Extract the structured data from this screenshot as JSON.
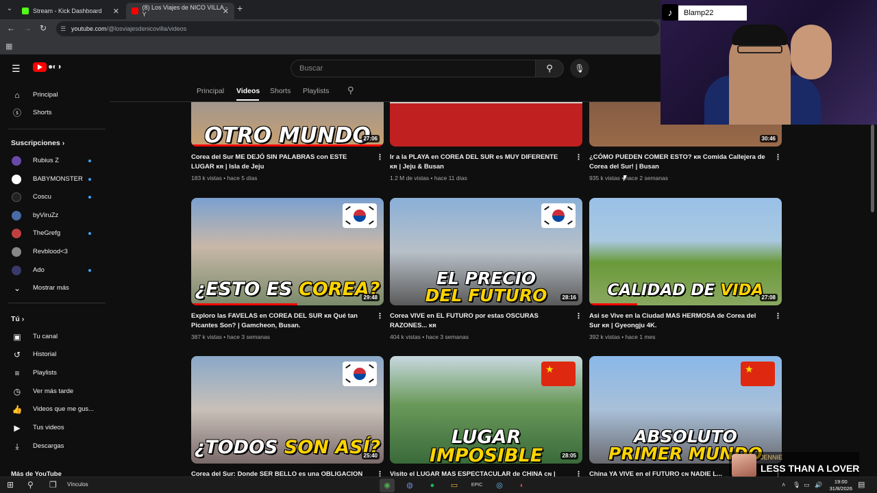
{
  "browser": {
    "tabs": [
      {
        "title": "Stream - Kick Dashboard",
        "favicon_color": "#53fc18"
      },
      {
        "title": "(8) Los Viajes de NICO VILLA - Y",
        "favicon_color": "#ff0000"
      }
    ],
    "url_host": "youtube.com",
    "url_path": "/@losviajesdenicovilla/videos"
  },
  "youtube": {
    "search_placeholder": "Buscar",
    "channel_tabs": [
      "Principal",
      "Videos",
      "Shorts",
      "Playlists"
    ],
    "active_tab": "Videos"
  },
  "sidebar": {
    "main": [
      {
        "label": "Principal",
        "icon": "home-icon"
      },
      {
        "label": "Shorts",
        "icon": "shorts-icon"
      }
    ],
    "subs_heading": "Suscripciones",
    "subscriptions": [
      {
        "label": "Rubius Z",
        "avatar_color": "#6a4aa8",
        "live_dot": true
      },
      {
        "label": "BABYMONSTER",
        "avatar_color": "#ffffff",
        "live_dot": true
      },
      {
        "label": "Coscu",
        "avatar_color": "#222222",
        "live_dot": true
      },
      {
        "label": "byViruZz",
        "avatar_color": "#4a6aa8",
        "live_dot": false
      },
      {
        "label": "TheGrefg",
        "avatar_color": "#c04040",
        "live_dot": true
      },
      {
        "label": "Revblood<3",
        "avatar_color": "#888888",
        "live_dot": false
      },
      {
        "label": "Ado",
        "avatar_color": "#3a3a6a",
        "live_dot": true
      }
    ],
    "show_more": "Mostrar más",
    "you_heading": "Tú",
    "you_items": [
      {
        "label": "Tu canal",
        "icon": "channel-icon"
      },
      {
        "label": "Historial",
        "icon": "history-icon"
      },
      {
        "label": "Playlists",
        "icon": "playlists-icon"
      },
      {
        "label": "Ver más tarde",
        "icon": "watch-later-icon"
      },
      {
        "label": "Videos que me gus...",
        "icon": "like-icon"
      },
      {
        "label": "Tus videos",
        "icon": "your-videos-icon"
      },
      {
        "label": "Descargas",
        "icon": "downloads-icon"
      }
    ],
    "more_heading": "Más de YouTube"
  },
  "videos": [
    {
      "title": "Corea del Sur ME DEJÓ SIN PALABRAS con ESTE LUGAR ᴋʀ | Isla de Jeju",
      "meta": "183 k vistas • hace 5 días",
      "duration": "27:06",
      "caption_white": "OTRO MUNDO",
      "caption_yellow": "",
      "flag": "",
      "progress": 1.0,
      "scene": "linear-gradient(180deg,#6a8ab8,#c9a070)"
    },
    {
      "title": "Ir a la PLAYA en COREA DEL SUR es MUY DIFERENTE ᴋʀ | Jeju & Busan",
      "meta": "1.2 M de vistas • hace 11 días",
      "duration": "",
      "caption_white": "",
      "caption_yellow": "",
      "flag": "",
      "progress": 0,
      "scene": "linear-gradient(180deg,#a8b0b8,#d8d0c8)"
    },
    {
      "title": "¿CÓMO PUEDEN COMER ESTO? ᴋʀ Comida Callejera de Corea del Sur! | Busan",
      "meta": "935 k vistas • hace 2 semanas",
      "duration": "30:46",
      "caption_white": "",
      "caption_yellow": "",
      "flag": "",
      "progress": 0,
      "scene": "linear-gradient(180deg,#6a4a3a,#9a6a4a)"
    },
    {
      "title": "Exploro las FAVELAS en COREA DEL SUR ᴋʀ Qué tan Picantes Son? | Gamcheon, Busan.",
      "meta": "387 k vistas • hace 3 semanas",
      "duration": "29:48",
      "caption_white": "¿ESTO ES ",
      "caption_yellow": "COREA?",
      "flag": "kr",
      "progress": 0.55,
      "scene": "linear-gradient(180deg,#7aa0d0 0%,#c8b8a8 45%,#7a8a6a 100%)"
    },
    {
      "title": "Corea VIVE en EL FUTURO por estas OSCURAS RAZONES... ᴋʀ",
      "meta": "404 k vistas • hace 3 semanas",
      "duration": "28:16",
      "caption_white": "EL PRECIO",
      "caption_yellow": "DEL FUTURO",
      "flag": "kr",
      "progress": 0,
      "scene": "linear-gradient(180deg,#8ab0d8 0%,#b8c0c8 50%,#5a5a5a 100%)"
    },
    {
      "title": "Asi se Vive en la Ciudad MAS HERMOSA de Corea del Sur ᴋʀ | Gyeongju 4K.",
      "meta": "392 k vistas • hace 1 mes",
      "duration": "27:08",
      "caption_white": "CALIDAD DE ",
      "caption_yellow": "VIDA",
      "flag": "",
      "progress": 0.25,
      "scene": "linear-gradient(180deg,#9ac0e8 0%,#a8c8e0 40%,#6a9a3a 60%,#8aa860 100%)"
    },
    {
      "title": "Corea del Sur: Donde SER BELLO es una OBLIGACION",
      "meta": "",
      "duration": "25:40",
      "caption_white": "¿TODOS ",
      "caption_yellow": "SON ASÍ?",
      "flag": "kr",
      "progress": 0,
      "scene": "linear-gradient(180deg,#8aa8c8 0%,#c8c0b8 50%,#7a6a6a 100%)"
    },
    {
      "title": "Visito el LUGAR MAS ESPECTACULAR de CHINA ᴄɴ |",
      "meta": "",
      "duration": "28:05",
      "caption_white": "LUGAR",
      "caption_yellow": "IMPOSIBLE",
      "flag": "cn",
      "progress": 0,
      "scene": "linear-gradient(180deg,#c8d8e0 0%,#6a9a5a 45%,#3a6a3a 100%)"
    },
    {
      "title": "China YA VIVE en el FUTURO ᴄɴ NADIE L...",
      "meta": "",
      "duration": "",
      "caption_white": "ABSOLUTO",
      "caption_yellow": "PRIMER MUNDO",
      "flag": "cn",
      "progress": 0,
      "scene": "linear-gradient(180deg,#8ab8e8 0%,#a8c0d8 50%,#6a6a70 100%)"
    }
  ],
  "stream_overlay": {
    "username": "Blamp22",
    "music_artist": "JENNIE",
    "music_title": "LESS THAN A LOVER"
  },
  "taskbar": {
    "links_label": "Vínculos",
    "time": "19:00",
    "date": "31/8/2026"
  }
}
